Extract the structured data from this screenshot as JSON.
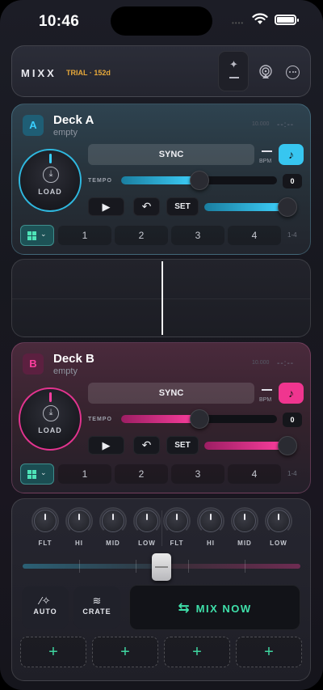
{
  "status": {
    "time": "10:46",
    "signal": "••••"
  },
  "header": {
    "brand": "MIXX",
    "trial": "TRIAL · 152d",
    "ai_icon": "sparkle-icon",
    "airplay_icon": "airplay-icon",
    "more_icon": "more-icon"
  },
  "deck_a": {
    "badge": "A",
    "name": "Deck A",
    "state": "empty",
    "bpm_small": "10.000",
    "time": "--:--",
    "load": "LOAD",
    "sync": "SYNC",
    "bpm_label": "BPM",
    "tempo_label": "TEMPO",
    "tempo_value": "0",
    "tempo_level": 0.5,
    "volume_level": 1.0,
    "set": "SET",
    "hotcues": [
      "1",
      "2",
      "3",
      "4"
    ],
    "range": "1-4",
    "accent": "#39d0ff"
  },
  "deck_b": {
    "badge": "B",
    "name": "Deck B",
    "state": "empty",
    "bpm_small": "10.000",
    "time": "--:--",
    "load": "LOAD",
    "sync": "SYNC",
    "bpm_label": "BPM",
    "tempo_label": "TEMPO",
    "tempo_value": "0",
    "tempo_level": 0.5,
    "volume_level": 1.0,
    "set": "SET",
    "hotcues": [
      "1",
      "2",
      "3",
      "4"
    ],
    "range": "1-4",
    "accent": "#ff3fa0"
  },
  "mixer": {
    "eq_labels": [
      "FLT",
      "HI",
      "MID",
      "LOW",
      "FLT",
      "HI",
      "MID",
      "LOW"
    ],
    "crossfader_level": 0.5,
    "auto": "AUTO",
    "crate": "CRATE",
    "mix_now": "MIX NOW",
    "slots": [
      "+",
      "+",
      "+",
      "+"
    ],
    "accent": "#3fe0aa"
  }
}
